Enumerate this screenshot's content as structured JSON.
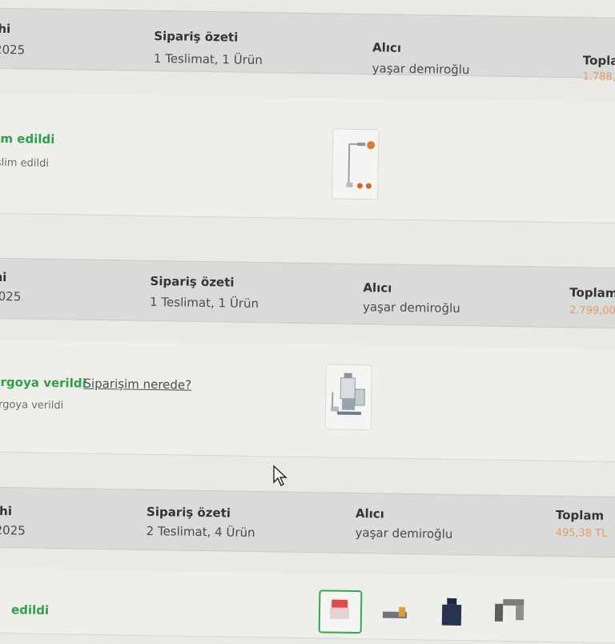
{
  "orders": [
    {
      "header": {
        "date_label": "hi",
        "date_value": "2025",
        "summary_label": "Sipariş özeti",
        "summary_value": "1 Teslimat, 1 Ürün",
        "recipient_label": "Alıcı",
        "recipient_value": "yaşar demiroğlu",
        "total_label": "Toplam",
        "total_value": "1.788,"
      },
      "status": {
        "title": "im edildi",
        "subtitle": "slim edildi"
      },
      "product_icon": "shower-set-icon"
    },
    {
      "header": {
        "date_label": "hi",
        "date_value": "2025",
        "summary_label": "Sipariş özeti",
        "summary_value": "1 Teslimat, 1 Ürün",
        "recipient_label": "Alıcı",
        "recipient_value": "yaşar demiroğlu",
        "total_label": "Toplam",
        "total_value": "2.799,00"
      },
      "status": {
        "title": "argoya verildi",
        "subtitle": "argoya verildi",
        "link": "Siparişim nerede?"
      },
      "product_icon": "food-processor-icon"
    },
    {
      "header": {
        "date_label": "ihi",
        "date_value": "2025",
        "summary_label": "Sipariş özeti",
        "summary_value": "2 Teslimat, 4 Ürün",
        "recipient_label": "Alıcı",
        "recipient_value": "yaşar demiroğlu",
        "total_label": "Toplam",
        "total_value": "495,38 TL"
      },
      "status": {
        "title": "edildi"
      },
      "product_icons": [
        "product-box-icon",
        "tool-icon",
        "bottle-icon",
        "clamp-icon"
      ]
    }
  ],
  "colors": {
    "status_green": "#2e9f4a",
    "total_orange": "#e99a63"
  }
}
